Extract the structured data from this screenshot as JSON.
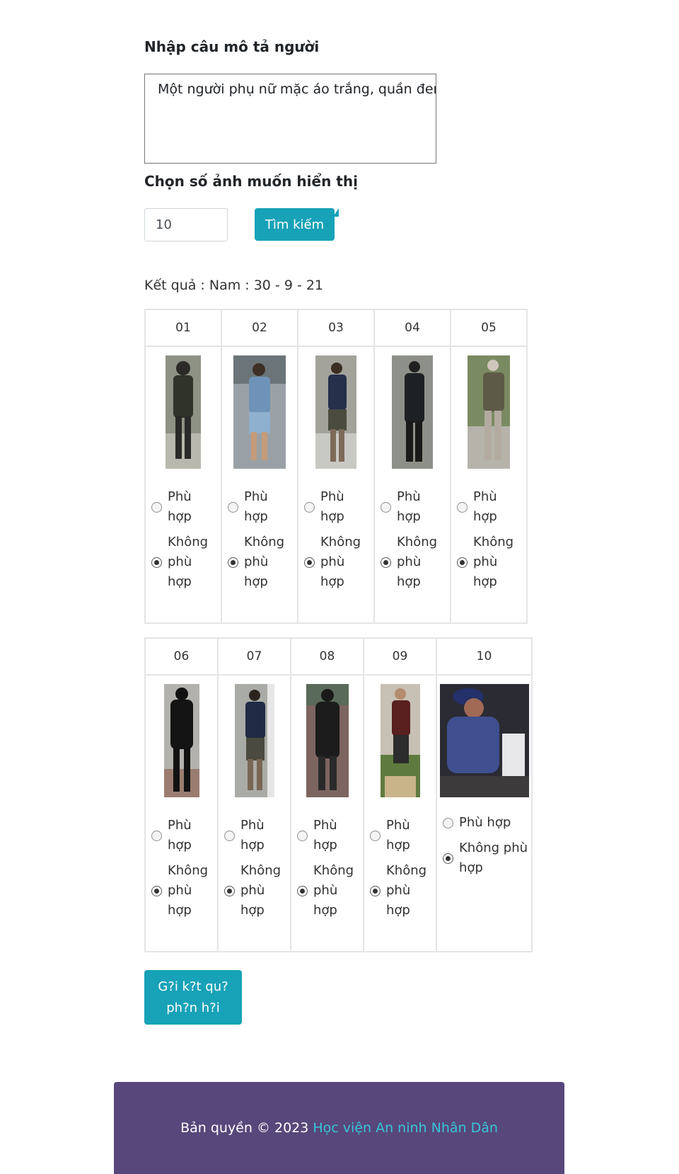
{
  "form": {
    "description_label": "Nhập câu mô tả người",
    "description_value": "Một người phụ nữ mặc áo trắng, quần đen",
    "count_label": "Chọn số ảnh muốn hiển thị",
    "count_value": "10",
    "search_button": "Tìm kiếm"
  },
  "result_text": "Kết quả : Nam : 30 - 9 - 21",
  "option_labels": {
    "match": "Phù hợp",
    "no_match": "Không phù hợp"
  },
  "results": [
    {
      "id": "01",
      "selected": "no_match"
    },
    {
      "id": "02",
      "selected": "no_match"
    },
    {
      "id": "03",
      "selected": "no_match"
    },
    {
      "id": "04",
      "selected": "no_match"
    },
    {
      "id": "05",
      "selected": "no_match"
    },
    {
      "id": "06",
      "selected": "no_match"
    },
    {
      "id": "07",
      "selected": "no_match"
    },
    {
      "id": "08",
      "selected": "no_match"
    },
    {
      "id": "09",
      "selected": "no_match"
    },
    {
      "id": "10",
      "selected": "no_match"
    }
  ],
  "submit_button": "G?i k?t qu? ph?n h?i",
  "footer": {
    "text": "Bản quyền © 2023 ",
    "link": "Học viện An ninh Nhân Dân"
  }
}
